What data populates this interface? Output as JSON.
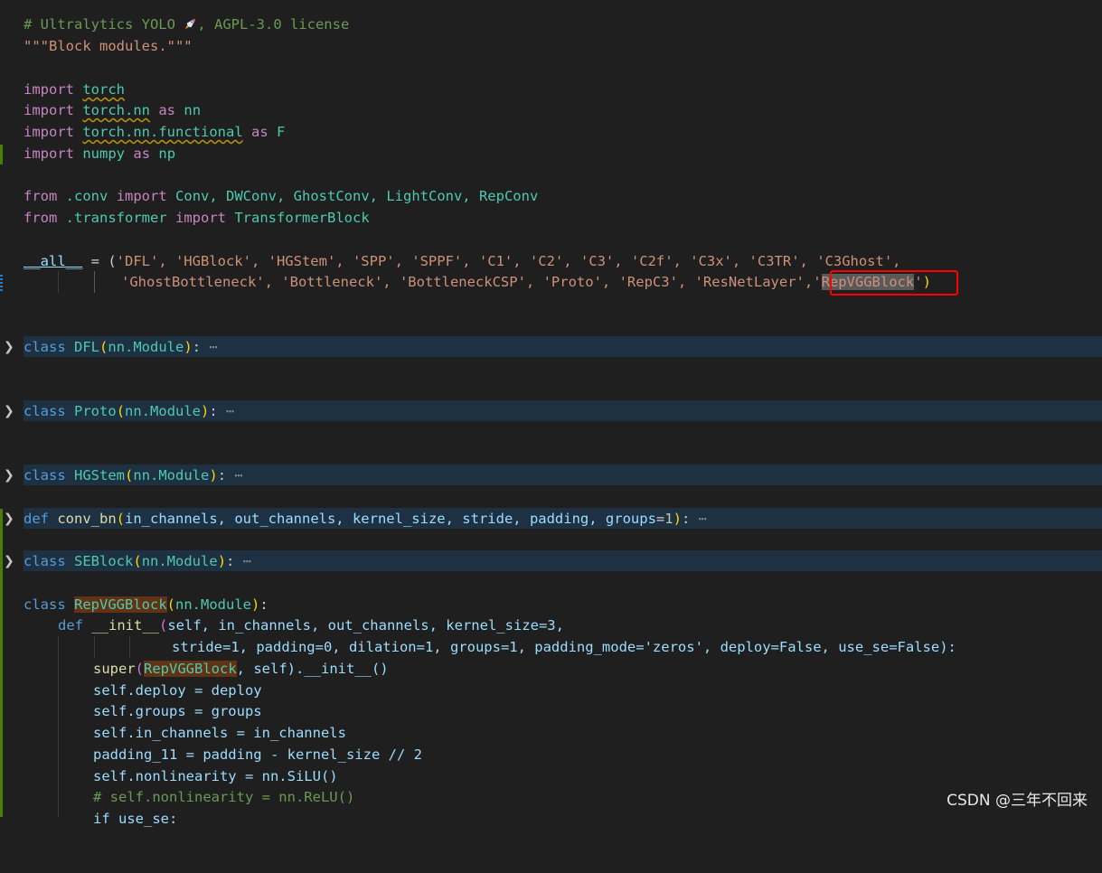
{
  "editor": {
    "header_comment": "# Ultralytics YOLO",
    "header_comment_license": ", AGPL-3.0 license",
    "docstring": "\"\"\"Block modules.\"\"\"",
    "imports": {
      "kw_import": "import",
      "kw_as": "as",
      "kw_from": "from",
      "torch": "torch",
      "torch_nn": "torch.nn",
      "nn": "nn",
      "torch_nn_functional": "torch.nn.functional",
      "F": "F",
      "numpy": "numpy",
      "np": "np",
      "conv_mod": ".conv",
      "conv_names": "Conv, DWConv, GhostConv, LightConv, RepConv",
      "transformer_mod": ".transformer",
      "transformer_names": "TransformerBlock"
    },
    "all_line1_name": "__all__",
    "all_line1_rest": " = (",
    "all_line1_strings": "'DFL', 'HGBlock', 'HGStem', 'SPP', 'SPPF', 'C1', 'C2', 'C3', 'C2f', 'C3x', 'C3TR', 'C3Ghost',",
    "all_line2_strings": "'GhostBottleneck', 'Bottleneck', 'BottleneckCSP', 'Proto', 'RepC3', 'ResNetLayer',",
    "all_line2_last": "RepVGGBlock",
    "folded": {
      "dfl": "DFL",
      "proto": "Proto",
      "hgstem": "HGStem",
      "conv_bn_name": "conv_bn",
      "conv_bn_params": "in_channels, out_channels, kernel_size, stride, padding, groups",
      "seblock": "SEBlock",
      "base": "nn.Module",
      "ellipsis": "⋯"
    },
    "repvgg": {
      "class_kw": "class",
      "def_kw": "def",
      "name": "RepVGGBlock",
      "base": "nn.Module",
      "init_name": "__init__",
      "init_params1": "self, in_channels, out_channels, kernel_size=3,",
      "init_params2": "stride=1, padding=0, dilation=1, groups=1, padding_mode='zeros', deploy=False, use_se=False):",
      "super_line_rest": ", self).__init__()",
      "body": [
        "self.deploy = deploy",
        "self.groups = groups",
        "self.in_channels = in_channels",
        "padding_11 = padding - kernel_size // 2",
        "self.nonlinearity = nn.SiLU()"
      ],
      "comment_line": "# self.nonlinearity = nn.ReLU()",
      "last_line": "if use_se:"
    }
  },
  "watermark": "CSDN @三年不回来",
  "colors": {
    "background": "#1f1f1f",
    "folded_line_bg": "#1e3143",
    "highlight_box": "#ff0000",
    "keyword": "#c586c0",
    "class_name": "#4ec9b0",
    "string": "#ce9178"
  },
  "icons": [
    "chevron-right-icon",
    "rocket-icon"
  ]
}
